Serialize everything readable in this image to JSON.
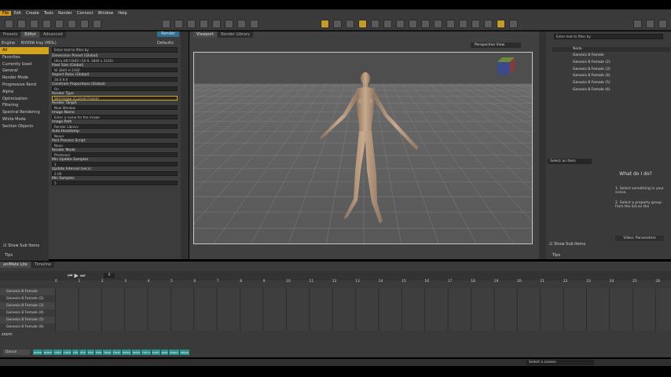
{
  "menu": [
    "File",
    "Edit",
    "Create",
    "Tools",
    "Render",
    "Connect",
    "Window",
    "Help"
  ],
  "left": {
    "tabs": [
      "Presets",
      "Editor",
      "Advanced"
    ],
    "render_btn": "Render",
    "defaults": "Defaults",
    "engine_label": "Engine",
    "engine_value": "NVIDIA Iray (MDL)",
    "side": [
      "All",
      "Favorites",
      "Currently Used",
      "General",
      "Render Mode",
      "Progressive Rend",
      "Alpha",
      "Optimization",
      "Filtering",
      "Spectral Rendering",
      "White Mode",
      "Section Objects"
    ],
    "filter": "Enter text to filter by",
    "props": [
      {
        "l": "Dimension Preset (Global)",
        "v": "Ultra HD [UHD] (16:9, 3840 x 2160)",
        "x": "Save"
      },
      {
        "l": "Pixel Size (Global)",
        "v": "W 3840   H 2160"
      },
      {
        "l": "Aspect Ratio (Global)",
        "v": "16.0   9.0"
      },
      {
        "l": "Constrain Proportions (Global)",
        "v": "On"
      },
      {
        "l": "Render Type",
        "v": "Still Image (Current Frame)"
      },
      {
        "l": "Render Target",
        "v": "New Window"
      },
      {
        "l": "Image Name",
        "v": "Enter a name for the image",
        "x": "png"
      },
      {
        "l": "Image Path",
        "v": "Render Library"
      },
      {
        "l": "Auto Headlamp",
        "v": "Never"
      },
      {
        "l": "Post Process Script",
        "v": "None"
      },
      {
        "l": "Render Mode",
        "v": "Photoreal"
      },
      {
        "l": "Min Update Samples",
        "v": "1"
      },
      {
        "l": "Update Interval (secs)",
        "v": "2.00"
      },
      {
        "l": "Min Samples",
        "v": "5"
      }
    ],
    "show_sub": "Show Sub Items",
    "tips": "Tips"
  },
  "viewport": {
    "tabs": [
      "Viewport",
      "Render Library"
    ],
    "aspect": "16 : 9",
    "view": "Perspective View"
  },
  "scene": {
    "filter": "Enter text to filter by",
    "col_node": "Node",
    "items": [
      "Genesis 8 Female",
      "Genesis 8 Female (2)",
      "Genesis 8 Female (3)",
      "Genesis 8 Female (4)",
      "Genesis 8 Female (5)",
      "Genesis 8 Female (6)"
    ],
    "select": "Select an Item",
    "help_title": "What do I do?",
    "help1": "1. Select something in your scene.",
    "help2": "2. Select a property group from the list on the",
    "video": "Video: Parameters",
    "show_sub": "Show Sub Items",
    "tips": "Tips"
  },
  "timeline": {
    "tabs": [
      "aniMate Lite",
      "Timeline"
    ],
    "frame": "0",
    "ticks": [
      "0",
      "1",
      "2",
      "3",
      "4",
      "5",
      "6",
      "7",
      "8",
      "9",
      "10",
      "11",
      "12",
      "13",
      "14",
      "15",
      "16",
      "17",
      "18",
      "19",
      "20",
      "21",
      "22",
      "23",
      "24",
      "25",
      "26"
    ],
    "tracks": [
      "Genesis 8 Female",
      "Genesis 8 Female (2)",
      "Genesis 8 Female (3)",
      "Genesis 8 Female (4)",
      "Genesis 8 Female (5)",
      "Genesis 8 Female (6)"
    ],
    "zoom": "zoom",
    "cat": "Dance",
    "clips": [
      "arme",
      "arme",
      "clubl",
      "clubl",
      "clle",
      "slle",
      "rlse",
      "rlws",
      "facsl",
      "facsl",
      "locks",
      "locks",
      "hst a",
      "scah",
      "spin",
      "stayn",
      "stayn"
    ]
  },
  "status": {
    "lesson": "Select a Lesson"
  },
  "colors": {
    "accent": "#d4a41a",
    "bg": "#3a3a3a"
  }
}
